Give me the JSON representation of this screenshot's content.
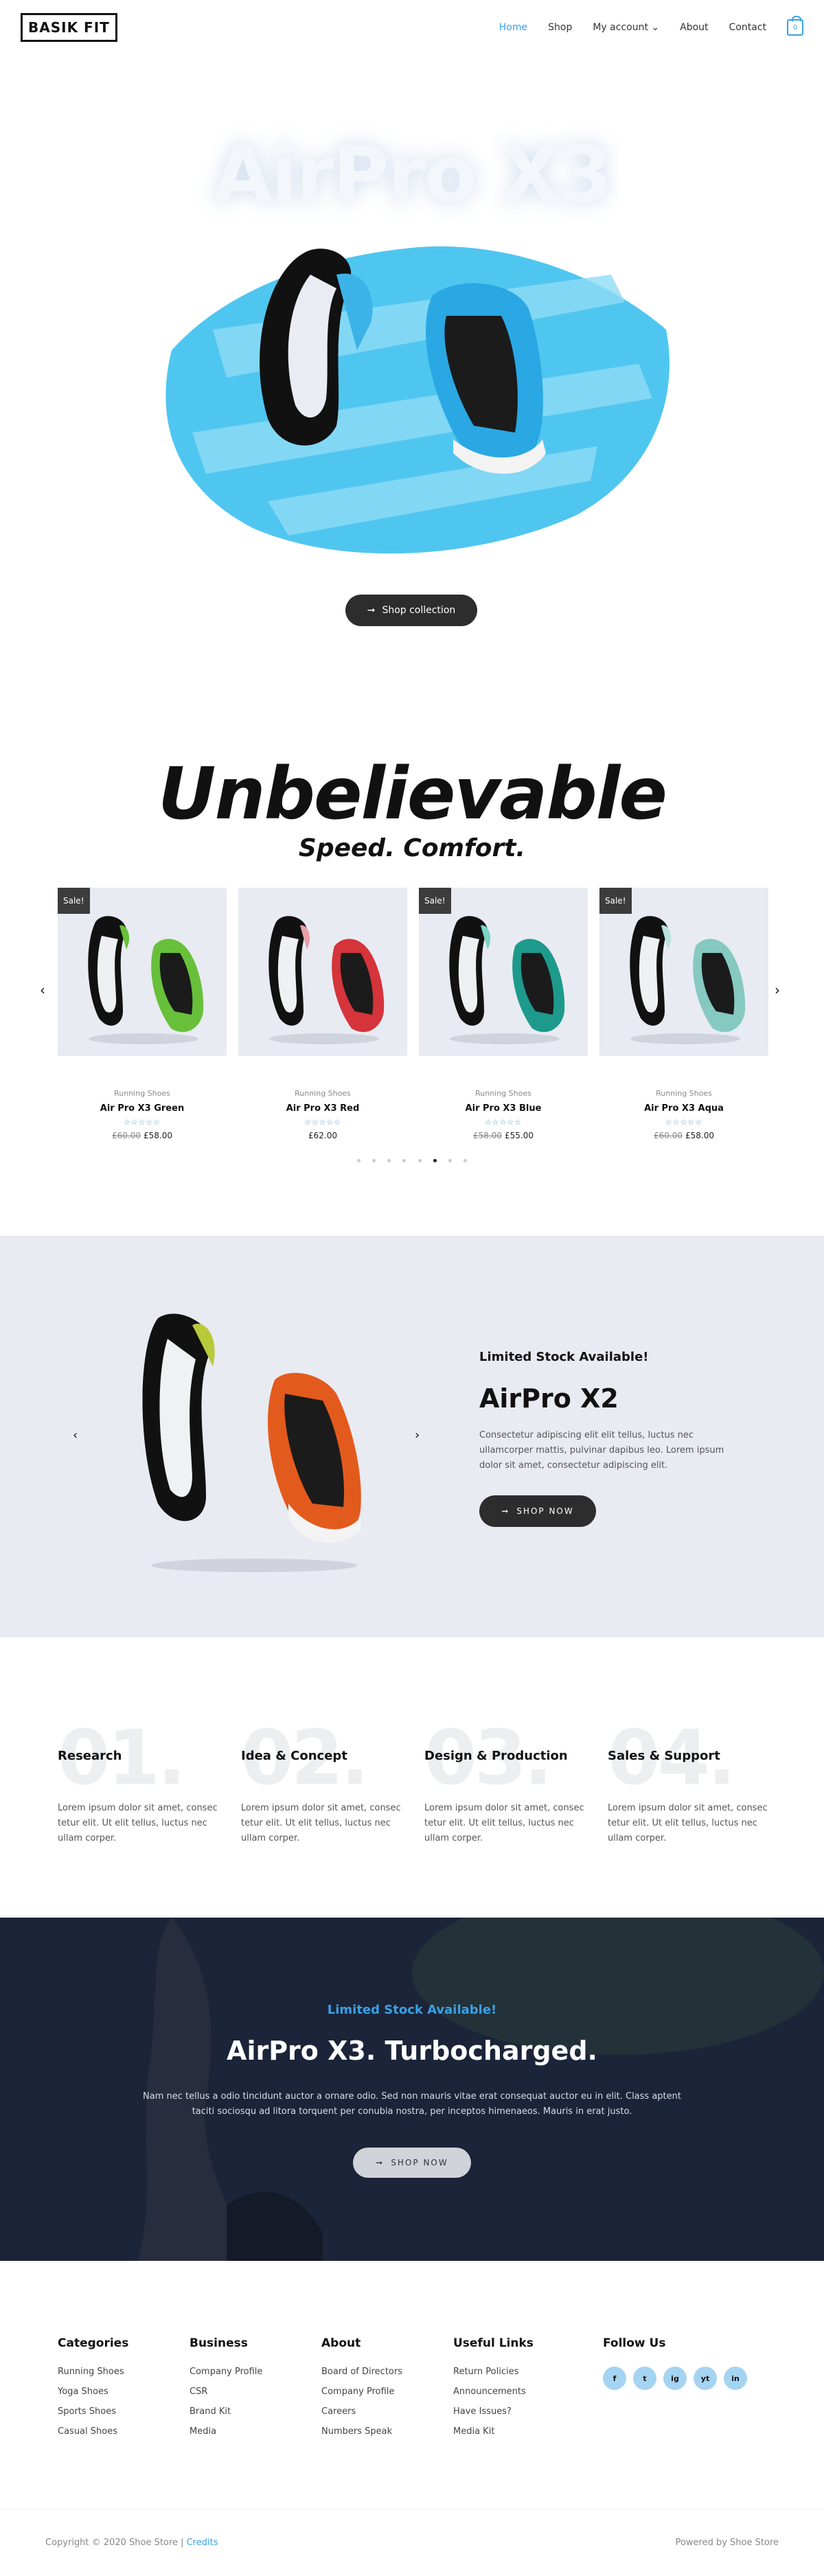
{
  "header": {
    "logo": "BASIK FIT",
    "nav": [
      "Home",
      "Shop",
      "My account",
      "About",
      "Contact"
    ],
    "nav_active": "Home",
    "cart_count": "0"
  },
  "hero": {
    "title": "AirPro X3",
    "button": "Shop collection"
  },
  "feature": {
    "title": "Unbelievable",
    "subtitle": "Speed. Comfort.",
    "products": [
      {
        "category": "Running Shoes",
        "name": "Air Pro X3 Green",
        "old_price": "£60.00",
        "price": "£58.00",
        "sale": "Sale!",
        "color": "#68c03a"
      },
      {
        "category": "Running Shoes",
        "name": "Air Pro X3 Red",
        "old_price": "",
        "price": "£62.00",
        "sale": "",
        "color": "#d4343a"
      },
      {
        "category": "Running Shoes",
        "name": "Air Pro X3 Blue",
        "old_price": "£58.00",
        "price": "£55.00",
        "sale": "Sale!",
        "color": "#1e9a8c"
      },
      {
        "category": "Running Shoes",
        "name": "Air Pro X3 Aqua",
        "old_price": "£60.00",
        "price": "£58.00",
        "sale": "Sale!",
        "color": "#86c9c1"
      }
    ],
    "stars": "☆☆☆☆☆",
    "dots_total": 8,
    "dots_active": 6
  },
  "x2": {
    "kicker": "Limited Stock Available!",
    "title": "AirPro X2",
    "desc": "Consectetur adipiscing elit elit tellus, luctus nec ullamcorper mattis, pulvinar dapibus leo. Lorem ipsum dolor sit amet, consectetur adipiscing elit.",
    "button": "SHOP NOW"
  },
  "steps": [
    {
      "num": "01.",
      "title": "Research",
      "text": "Lorem ipsum dolor sit amet, consec tetur elit. Ut elit tellus, luctus nec ullam corper."
    },
    {
      "num": "02.",
      "title": "Idea & Concept",
      "text": "Lorem ipsum dolor sit amet, consec tetur elit. Ut elit tellus, luctus nec ullam corper."
    },
    {
      "num": "03.",
      "title": "Design & Production",
      "text": "Lorem ipsum dolor sit amet, consec tetur elit. Ut elit tellus, luctus nec ullam corper."
    },
    {
      "num": "04.",
      "title": "Sales & Support",
      "text": "Lorem ipsum dolor sit amet, consec tetur elit. Ut elit tellus, luctus nec ullam corper."
    }
  ],
  "turbo": {
    "kicker": "Limited Stock Available!",
    "title": "AirPro X3. Turbocharged.",
    "text": "Nam nec tellus a odio tincidunt auctor a ornare odio. Sed non mauris vitae erat consequat auctor eu in elit. Class aptent taciti sociosqu ad litora torquent per conubia nostra, per inceptos himenaeos. Mauris in erat justo.",
    "button": "SHOP NOW"
  },
  "footer": {
    "columns": [
      {
        "title": "Categories",
        "links": [
          "Running Shoes",
          "Yoga Shoes",
          "Sports Shoes",
          "Casual Shoes"
        ]
      },
      {
        "title": "Business",
        "links": [
          "Company Profile",
          "CSR",
          "Brand Kit",
          "Media"
        ]
      },
      {
        "title": "About",
        "links": [
          "Board of Directors",
          "Company Profile",
          "Careers",
          "Numbers Speak"
        ]
      },
      {
        "title": "Useful Links",
        "links": [
          "Return Policies",
          "Announcements",
          "Have Issues?",
          "Media Kit"
        ]
      }
    ],
    "follow_title": "Follow Us",
    "social": [
      "f",
      "t",
      "ig",
      "yt",
      "in"
    ],
    "copyright": "Copyright © 2020 Shoe Store",
    "credits": "Credits",
    "powered": "Powered by Shoe Store"
  },
  "colors": {
    "accent": "#3aa0e6",
    "dark": "#2d2d2d",
    "soft_bg": "#e8ebf2",
    "navy": "#1b2438"
  }
}
